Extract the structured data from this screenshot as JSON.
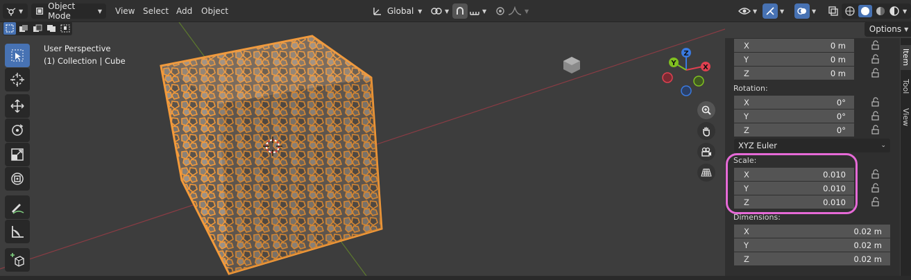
{
  "header": {
    "mode_label": "Object Mode",
    "menus": [
      "View",
      "Select",
      "Add",
      "Object"
    ],
    "orientation_label": "Global",
    "options_label": "Options"
  },
  "viewport": {
    "perspective_label": "User Perspective",
    "object_label": "(1) Collection | Cube",
    "gizmo_axes": [
      "X",
      "Y",
      "Z"
    ]
  },
  "panel": {
    "tabs": [
      "Item",
      "Tool",
      "View"
    ],
    "location": [
      {
        "axis": "X",
        "value": "0 m"
      },
      {
        "axis": "Y",
        "value": "0 m"
      },
      {
        "axis": "Z",
        "value": "0 m"
      }
    ],
    "rotation_label": "Rotation:",
    "rotation": [
      {
        "axis": "X",
        "value": "0°"
      },
      {
        "axis": "Y",
        "value": "0°"
      },
      {
        "axis": "Z",
        "value": "0°"
      }
    ],
    "rotation_mode": "XYZ Euler",
    "scale_label": "Scale:",
    "scale": [
      {
        "axis": "X",
        "value": "0.010"
      },
      {
        "axis": "Y",
        "value": "0.010"
      },
      {
        "axis": "Z",
        "value": "0.010"
      }
    ],
    "dimensions_label": "Dimensions:",
    "dimensions": [
      {
        "axis": "X",
        "value": "0.02 m"
      },
      {
        "axis": "Y",
        "value": "0.02 m"
      },
      {
        "axis": "Z",
        "value": "0.02 m"
      }
    ]
  },
  "colors": {
    "accent": "#4772b3",
    "selection_orange": "#f0a040",
    "highlight": "#e66ad7",
    "axis_x": "#e04050",
    "axis_y": "#80c020",
    "axis_z": "#3a7ae0"
  }
}
